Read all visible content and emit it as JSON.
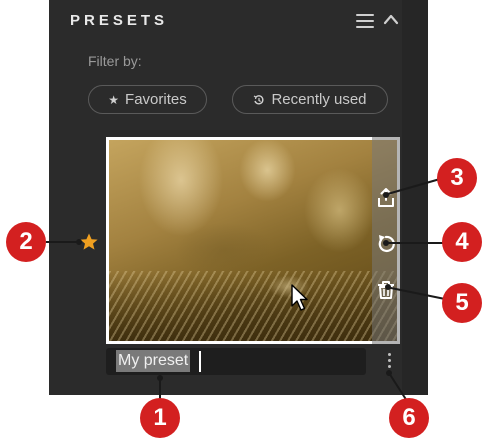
{
  "header": {
    "title": "PRESETS"
  },
  "filter": {
    "label": "Filter by:",
    "chips": [
      {
        "label": "Favorites",
        "icon": "star-icon"
      },
      {
        "label": "Recently used",
        "icon": "history-icon"
      }
    ]
  },
  "preset": {
    "name": "My preset",
    "favorite": true,
    "actions": [
      {
        "name": "share-icon"
      },
      {
        "name": "reset-icon"
      },
      {
        "name": "trash-icon"
      }
    ]
  },
  "callouts": [
    "1",
    "2",
    "3",
    "4",
    "5",
    "6"
  ],
  "colors": {
    "panel": "#2b2b2b",
    "accent_star": "#f0a020",
    "callout": "#d32020"
  }
}
